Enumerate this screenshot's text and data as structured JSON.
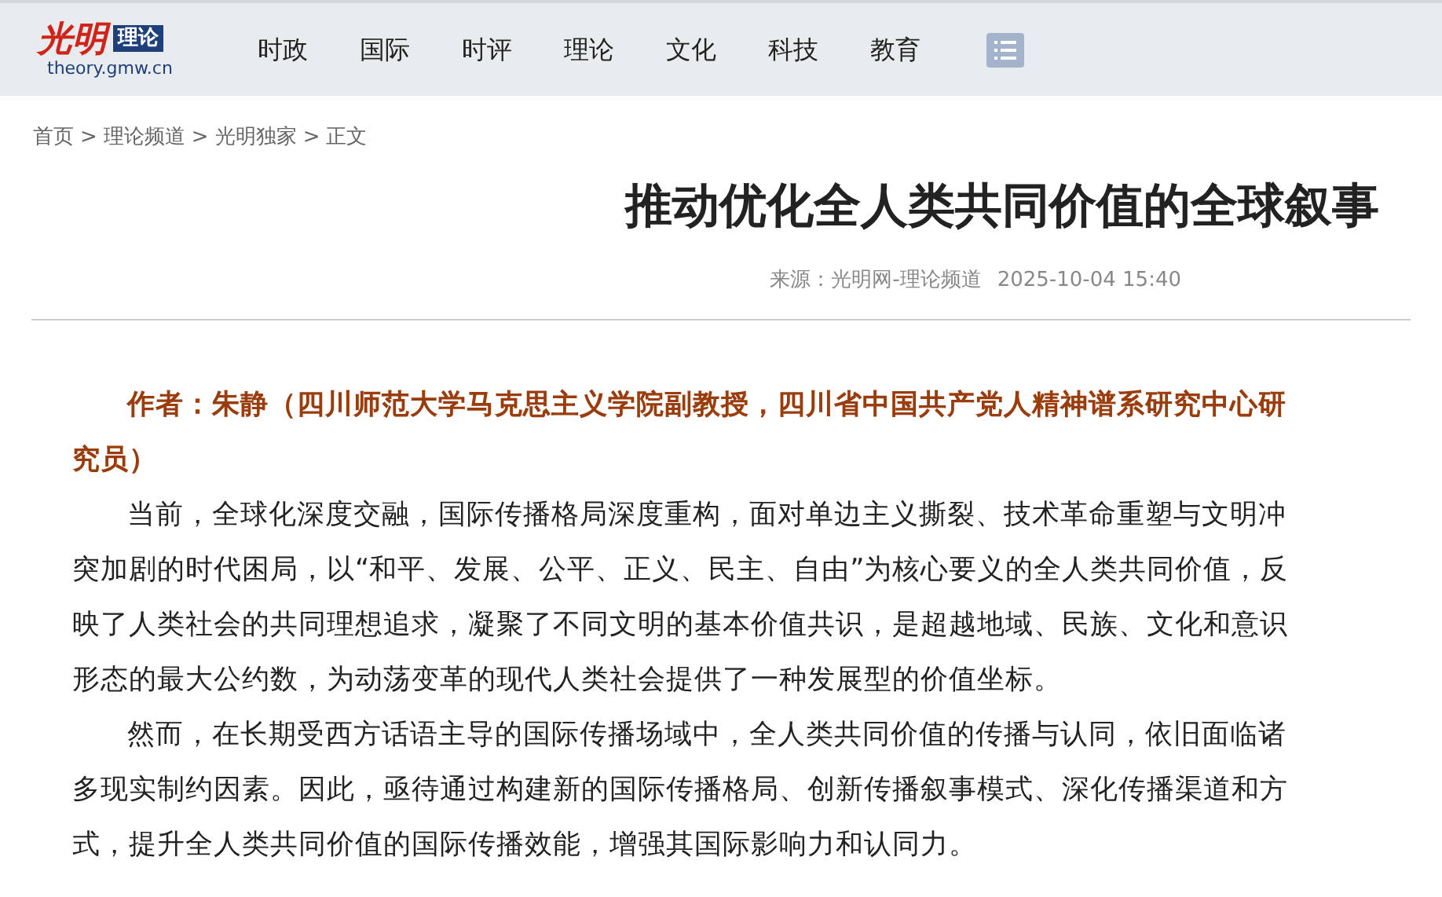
{
  "header": {
    "logo": {
      "mark": "光明",
      "badge": "理论",
      "url": "theory.gmw.cn"
    },
    "nav": [
      {
        "label": "时政"
      },
      {
        "label": "国际"
      },
      {
        "label": "时评"
      },
      {
        "label": "理论"
      },
      {
        "label": "文化"
      },
      {
        "label": "科技"
      },
      {
        "label": "教育"
      }
    ]
  },
  "breadcrumb": [
    {
      "label": "首页",
      "separator": ">"
    },
    {
      "label": "理论频道",
      "separator": ">"
    },
    {
      "label": "光明独家",
      "separator": ">"
    },
    {
      "label": "正文"
    }
  ],
  "article": {
    "title": "推动优化全人类共同价值的全球叙事",
    "source": "来源：光明网-理论频道",
    "date": "2025-10-04 15:40",
    "paragraphs": [
      {
        "kind": "author",
        "text": "作者：朱静（四川师范大学马克思主义学院副教授，四川省中国共产党人精神谱系研究中心研究员）"
      },
      {
        "kind": "body",
        "text": "当前，全球化深度交融，国际传播格局深度重构，面对单边主义撕裂、技术革命重塑与文明冲突加剧的时代困局，以“和平、发展、公平、正义、民主、自由”为核心要义的全人类共同价值，反映了人类社会的共同理想追求，凝聚了不同文明的基本价值共识，是超越地域、民族、文化和意识形态的最大公约数，为动荡变革的现代人类社会提供了一种发展型的价值坐标。"
      },
      {
        "kind": "body",
        "text": "然而，在长期受西方话语主导的国际传播场域中，全人类共同价值的传播与认同，依旧面临诸多现实制约因素。因此，亟待通过构建新的国际传播格局、创新传播叙事模式、深化传播渠道和方式，提升全人类共同价值的国际传播效能，增强其国际影响力和认同力。"
      }
    ]
  }
}
